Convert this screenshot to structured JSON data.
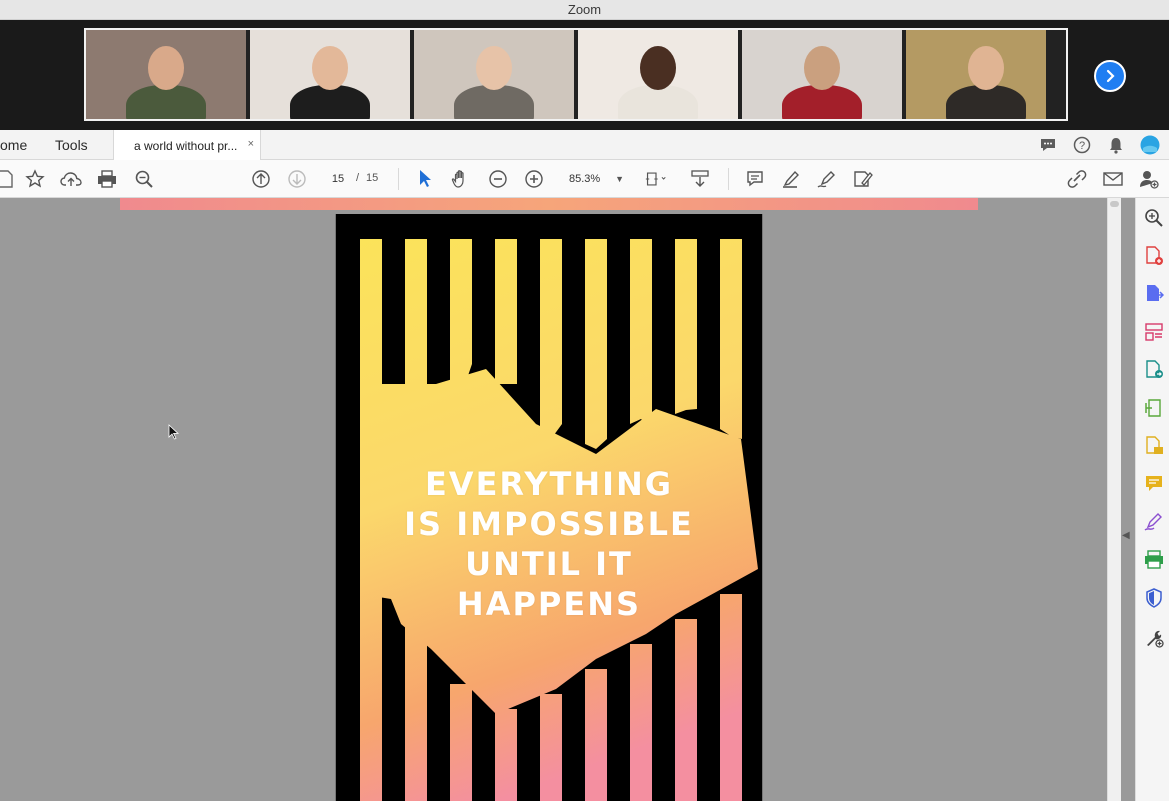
{
  "zoom": {
    "title": "Zoom",
    "participants": [
      {
        "id": "p1",
        "wall": "#8d7a70",
        "shirt": "#4b5a3c",
        "skin": "#d9a98a",
        "active": false
      },
      {
        "id": "p2",
        "wall": "#e6e0da",
        "shirt": "#1d1d1d",
        "skin": "#e3b899",
        "active": false
      },
      {
        "id": "p3",
        "wall": "#cfc6bd",
        "shirt": "#6f6a63",
        "skin": "#e7c3a8",
        "active": false
      },
      {
        "id": "p4",
        "wall": "#efe9e3",
        "shirt": "#e9e4dc",
        "skin": "#4a2f22",
        "active": true
      },
      {
        "id": "p5",
        "wall": "#d8d3cf",
        "shirt": "#a31f2a",
        "skin": "#caa07f",
        "active": false
      },
      {
        "id": "p6",
        "wall": "#b49a63",
        "shirt": "#2e2a27",
        "skin": "#e0b493",
        "active": false
      }
    ]
  },
  "acrobat": {
    "nav": {
      "home": "ome",
      "tools": "Tools"
    },
    "tab": {
      "label": "a world without pr...",
      "close": "×"
    },
    "toolbar": {
      "page_current": "15",
      "page_sep": "/",
      "page_total": "15",
      "zoom": "85.3%"
    }
  },
  "poster": {
    "lines": [
      "EVERYTHING",
      "IS IMPOSSIBLE",
      "UNTIL IT",
      "HAPPENS"
    ],
    "colors": {
      "top": "#fbe35a",
      "mid": "#fbd267",
      "bottom": "#f48fa0",
      "background": "#000000"
    }
  },
  "colors": {
    "accent": "#1f7ef2",
    "active_speaker": "#c4e53c"
  }
}
